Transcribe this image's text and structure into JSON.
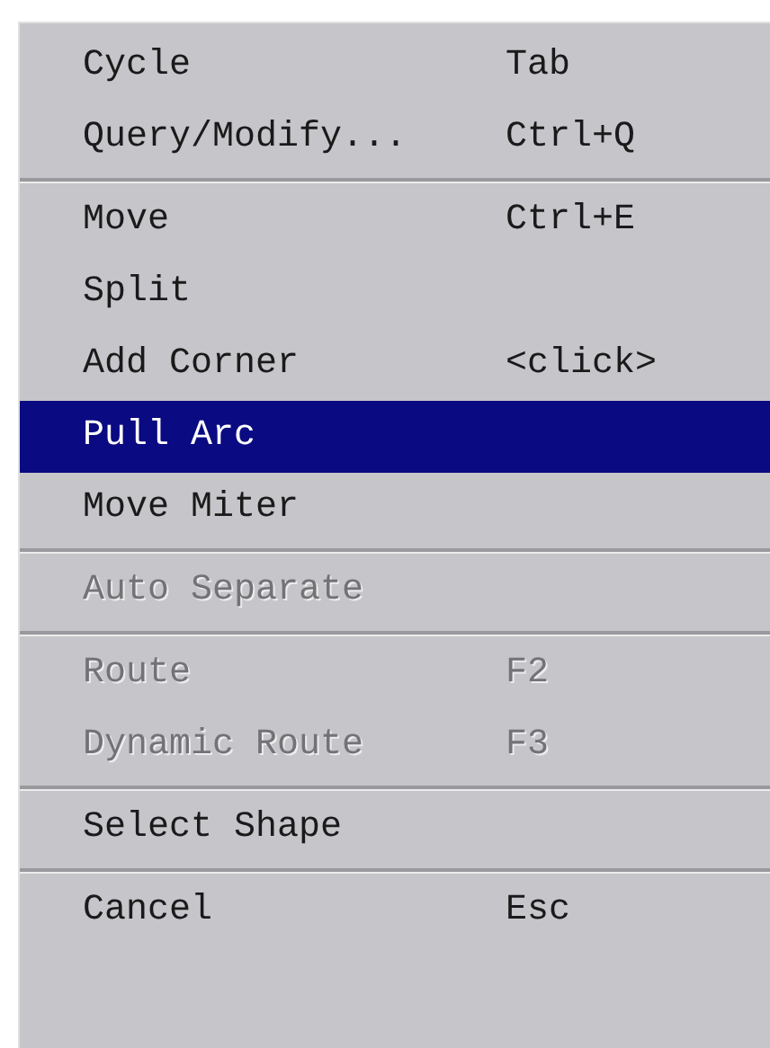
{
  "menu": {
    "groups": [
      {
        "items": [
          {
            "label": "Cycle",
            "shortcut": "Tab",
            "selected": false,
            "disabled": false
          },
          {
            "label": "Query/Modify...",
            "shortcut": "Ctrl+Q",
            "selected": false,
            "disabled": false
          }
        ]
      },
      {
        "items": [
          {
            "label": "Move",
            "shortcut": "Ctrl+E",
            "selected": false,
            "disabled": false
          },
          {
            "label": "Split",
            "selected": false,
            "disabled": false
          },
          {
            "label": "Add Corner",
            "shortcut": "<click>",
            "selected": false,
            "disabled": false
          },
          {
            "label": "Pull Arc",
            "selected": true,
            "disabled": false
          },
          {
            "label": "Move Miter",
            "selected": false,
            "disabled": false
          }
        ]
      },
      {
        "items": [
          {
            "label": "Auto Separate",
            "selected": false,
            "disabled": true
          }
        ]
      },
      {
        "items": [
          {
            "label": "Route",
            "shortcut": "F2",
            "selected": false,
            "disabled": true
          },
          {
            "label": "Dynamic Route",
            "shortcut": "F3",
            "selected": false,
            "disabled": true
          }
        ]
      },
      {
        "items": [
          {
            "label": "Select Shape",
            "selected": false,
            "disabled": false
          }
        ]
      },
      {
        "items": [
          {
            "label": "Cancel",
            "shortcut": "Esc",
            "selected": false,
            "disabled": false
          }
        ]
      }
    ]
  }
}
